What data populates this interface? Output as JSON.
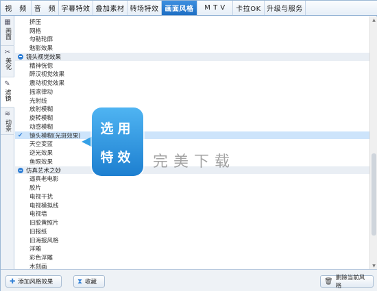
{
  "tabs": [
    {
      "label": "视　频",
      "active": false
    },
    {
      "label": "音　频",
      "active": false
    },
    {
      "label": "字幕特效",
      "active": false
    },
    {
      "label": "叠加素材",
      "active": false
    },
    {
      "label": "转场特效",
      "active": false
    },
    {
      "label": "画面风格",
      "active": true
    },
    {
      "label": "M T V",
      "active": false
    },
    {
      "label": "卡拉OK",
      "active": false
    },
    {
      "label": "升级与服务",
      "active": false
    }
  ],
  "side_tabs": [
    {
      "label": "画面",
      "icon": "▦",
      "active": false
    },
    {
      "label": "美化",
      "icon": "✂",
      "active": false
    },
    {
      "label": "滤镜",
      "icon": "✎",
      "active": true
    },
    {
      "label": "动景",
      "icon": "≋",
      "active": false
    }
  ],
  "list": [
    {
      "type": "item",
      "label": "挤压"
    },
    {
      "type": "item",
      "label": "网格"
    },
    {
      "type": "item",
      "label": "勾勒轮廓"
    },
    {
      "type": "item",
      "label": "魅影效果"
    },
    {
      "type": "group",
      "label": "镜头视觉效果"
    },
    {
      "type": "item",
      "label": "精神恍惚"
    },
    {
      "type": "item",
      "label": "醉汉视觉效果"
    },
    {
      "type": "item",
      "label": "震动视觉效果"
    },
    {
      "type": "item",
      "label": "摇滚律动"
    },
    {
      "type": "item",
      "label": "光射线"
    },
    {
      "type": "item",
      "label": "放射模糊"
    },
    {
      "type": "item",
      "label": "旋转模糊"
    },
    {
      "type": "item",
      "label": "动感模糊"
    },
    {
      "type": "item",
      "label": "镜头模糊(光斑效果)",
      "selected": true
    },
    {
      "type": "item",
      "label": "天空变蓝"
    },
    {
      "type": "item",
      "label": "逆光效果"
    },
    {
      "type": "item",
      "label": "鱼眼效果"
    },
    {
      "type": "group",
      "label": "仿真艺术之妙"
    },
    {
      "type": "item",
      "label": "逼真老电影"
    },
    {
      "type": "item",
      "label": "胶片"
    },
    {
      "type": "item",
      "label": "电视干扰"
    },
    {
      "type": "item",
      "label": "电视模拟线"
    },
    {
      "type": "item",
      "label": "电视墙"
    },
    {
      "type": "item",
      "label": "旧胶黄照片"
    },
    {
      "type": "item",
      "label": "旧报纸"
    },
    {
      "type": "item",
      "label": "旧海报风格"
    },
    {
      "type": "item",
      "label": "浮雕"
    },
    {
      "type": "item",
      "label": "彩色浮雕"
    },
    {
      "type": "item",
      "label": "木刻画"
    }
  ],
  "callout": {
    "line1": "选用",
    "line2": "特效"
  },
  "watermark": "完美下载",
  "bottom": {
    "add_label": "添加风格效果",
    "collect_label": "收藏",
    "delete_label": "删除当前风格"
  },
  "colors": {
    "accent": "#1e6fc4",
    "selected_row": "#cde4fb",
    "group_row": "#e9eef4"
  }
}
